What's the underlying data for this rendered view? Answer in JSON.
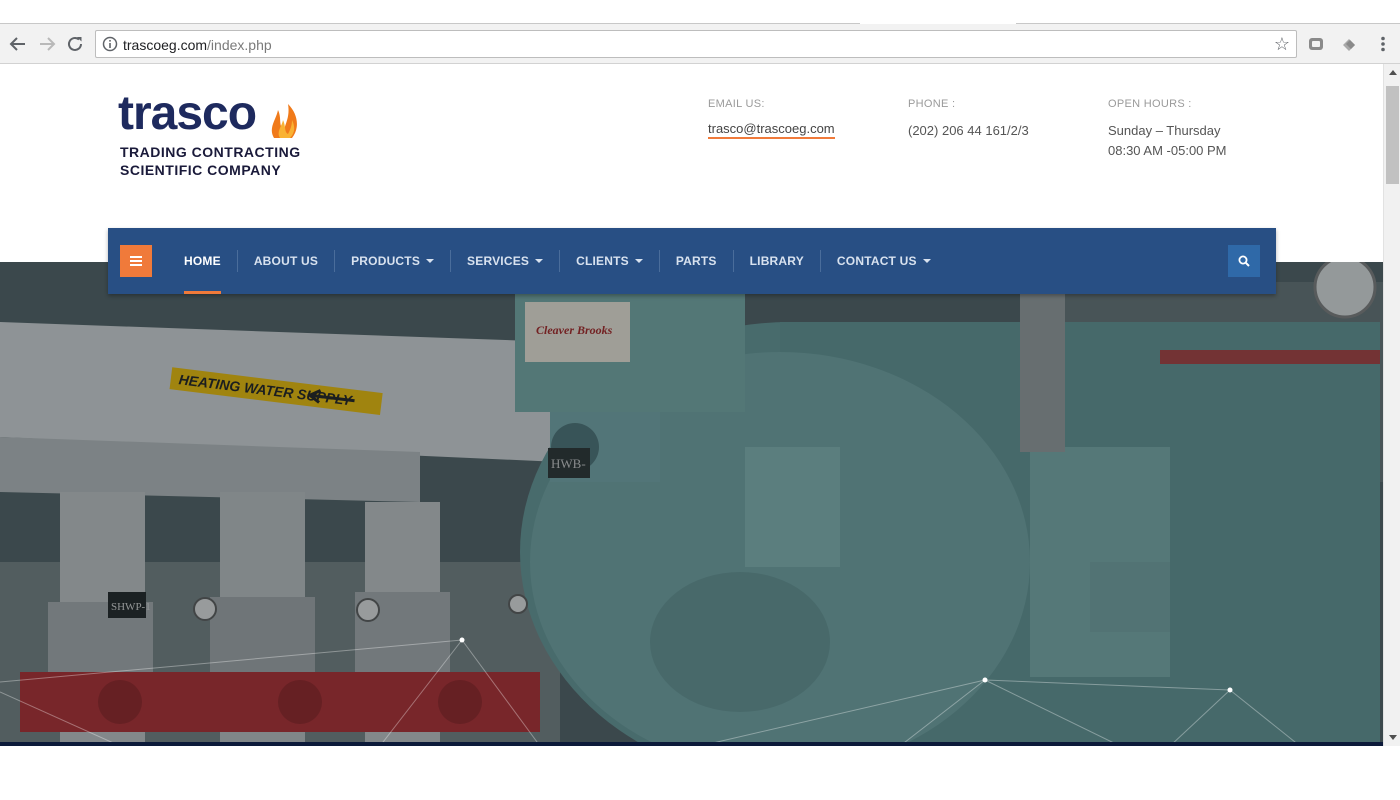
{
  "browser": {
    "url_domain": "trascoeg.com",
    "url_path": "/index.php"
  },
  "logo": {
    "wordmark": "trasco",
    "tagline_1": "TRADING CONTRACTING",
    "tagline_2": "SCIENTIFIC  COMPANY"
  },
  "contact": {
    "email_label": "EMAIL US:",
    "email_value": "trasco@trascoeg.com",
    "phone_label": "PHONE :",
    "phone_value": "(202) 206 44 161/2/3",
    "hours_label": "OPEN HOURS :",
    "hours_days": "Sunday – Thursday",
    "hours_time": "08:30 AM -05:00 PM"
  },
  "nav": {
    "items": [
      {
        "label": "HOME",
        "active": true,
        "dropdown": false
      },
      {
        "label": "ABOUT US",
        "active": false,
        "dropdown": false
      },
      {
        "label": "PRODUCTS",
        "active": false,
        "dropdown": true
      },
      {
        "label": "SERVICES",
        "active": false,
        "dropdown": true
      },
      {
        "label": "CLIENTS",
        "active": false,
        "dropdown": true
      },
      {
        "label": "PARTS",
        "active": false,
        "dropdown": false
      },
      {
        "label": "LIBRARY",
        "active": false,
        "dropdown": false
      },
      {
        "label": "CONTACT US",
        "active": false,
        "dropdown": true
      }
    ]
  },
  "hero": {
    "sign_text": "HEATING WATER SUPPLY",
    "brand_plate": "Cleaver Brooks",
    "unit_label": "HWB-",
    "pump_label": "SHWP-1"
  },
  "colors": {
    "nav_bg": "#284f84",
    "accent": "#f07a3a",
    "logo_navy": "#1e2a5e"
  },
  "icons": {
    "menu": "hamburger-icon",
    "search": "search-icon",
    "bookmark": "star-icon",
    "info": "info-icon"
  }
}
